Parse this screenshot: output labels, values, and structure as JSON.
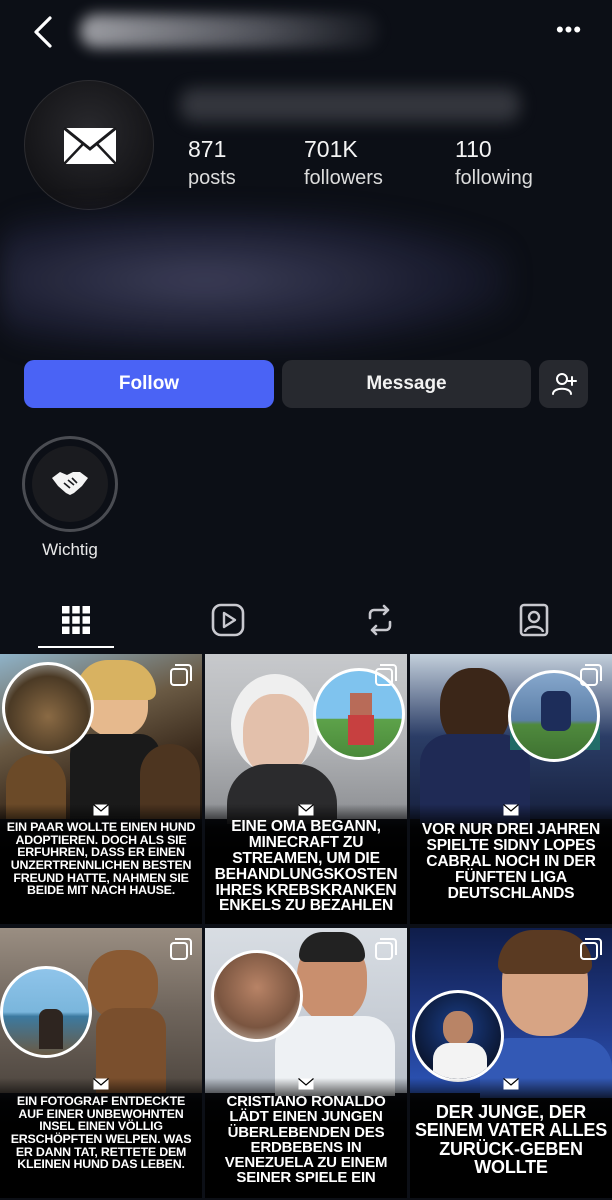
{
  "profile": {
    "stats": [
      {
        "value": "871",
        "label": "posts"
      },
      {
        "value": "701K",
        "label": "followers"
      },
      {
        "value": "110",
        "label": "following"
      }
    ]
  },
  "actions": {
    "follow_label": "Follow",
    "message_label": "Message"
  },
  "highlights": [
    {
      "label": "Wichtig"
    }
  ],
  "posts": [
    {
      "caption": "Ein Paar wollte einen Hund adoptieren. Doch als sie erfuhren, dass er einen unzertrennlichen besten Freund hatte, nahmen sie beide mit nach Hause."
    },
    {
      "caption": "Eine Oma begann, Minecraft zu streamen, um die Behandlungskosten ihres krebskranken Enkels zu bezahlen"
    },
    {
      "caption": "Vor nur drei Jahren spielte Sidny Lopes Cabral noch in der fünften Liga Deutschlands"
    },
    {
      "caption": "Ein Fotograf entdeckte auf einer unbewohnten Insel einen völlig erschöpften Welpen. Was er dann tat, rettete dem kleinen Hund das Leben."
    },
    {
      "caption": "Cristiano Ronaldo lädt einen jungen Überlebenden des Erdbebens in Venezuela zu einem seiner Spiele ein"
    },
    {
      "caption": "Der Junge, der seinem Vater alles zurück-geben wollte"
    }
  ],
  "colors": {
    "background": "#0c0f16",
    "follow_button": "#4a63f5",
    "secondary_button": "#27292f"
  }
}
